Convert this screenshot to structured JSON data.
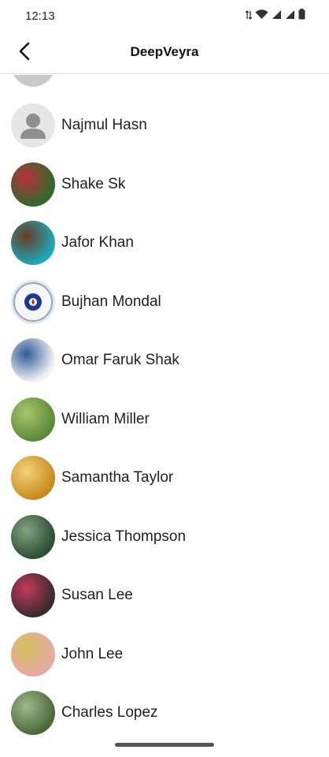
{
  "status_bar": {
    "time": "12:13",
    "icons": [
      "data-arrows-icon",
      "wifi-icon",
      "signal-icon",
      "signal-icon",
      "battery-icon"
    ]
  },
  "header": {
    "title": "DeepVeyra",
    "back_icon": "chevron-left-icon"
  },
  "contacts": [
    {
      "name": "Najmul Hasn",
      "avatar": "default-person-icon",
      "colors": [
        "#e6e6e6",
        "#8f8f8f"
      ]
    },
    {
      "name": "Shake Sk",
      "avatar": "photo",
      "colors": [
        "#2f6a2a",
        "#b8323a"
      ]
    },
    {
      "name": "Jafor Khan",
      "avatar": "photo",
      "colors": [
        "#1ba9b9",
        "#6b3a22"
      ]
    },
    {
      "name": "Bujhan Mondal",
      "avatar": "emblem",
      "colors": [
        "#dfe6ee",
        "#1c3a91"
      ]
    },
    {
      "name": "Omar Faruk Shak",
      "avatar": "photo",
      "colors": [
        "#f3f3f3",
        "#2f5a96"
      ]
    },
    {
      "name": "William Miller",
      "avatar": "photo",
      "colors": [
        "#5b8a3a",
        "#a8c66a"
      ]
    },
    {
      "name": "Samantha Taylor",
      "avatar": "photo",
      "colors": [
        "#c98a1e",
        "#f2d27a"
      ]
    },
    {
      "name": "Jessica Thompson",
      "avatar": "photo",
      "colors": [
        "#2e4f33",
        "#7fa37d"
      ]
    },
    {
      "name": "Susan Lee",
      "avatar": "photo",
      "colors": [
        "#3a2a2e",
        "#c33a5a"
      ]
    },
    {
      "name": "John Lee",
      "avatar": "photo",
      "colors": [
        "#e6a9a6",
        "#d4c25a"
      ]
    },
    {
      "name": "Charles Lopez",
      "avatar": "photo",
      "colors": [
        "#4a6a3a",
        "#9fb88a"
      ]
    }
  ]
}
